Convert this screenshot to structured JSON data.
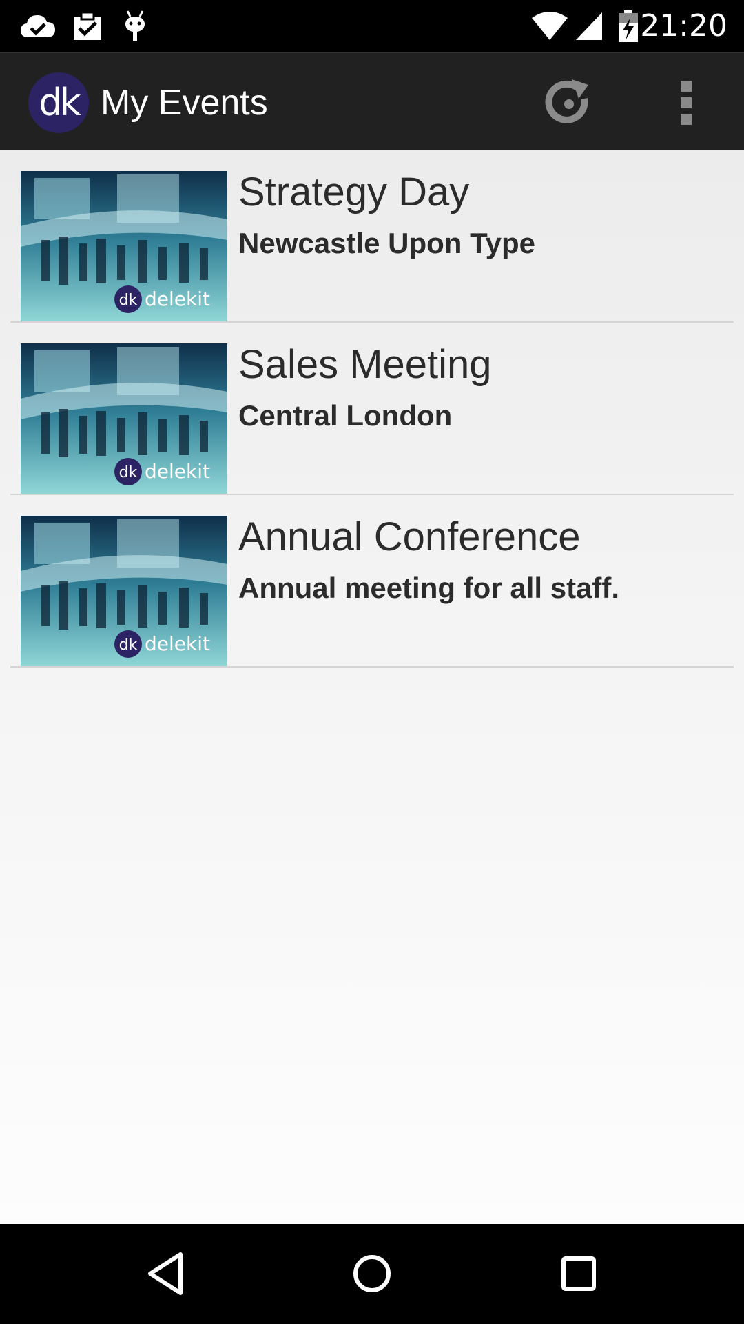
{
  "status_bar": {
    "time": "21:20",
    "icons": [
      "cloud-check-icon",
      "clipboard-check-icon",
      "android-debug-icon",
      "wifi-icon",
      "signal-icon",
      "battery-charging-icon"
    ]
  },
  "action_bar": {
    "logo_text": "dk",
    "title": "My Events",
    "actions": [
      "refresh-icon",
      "overflow-menu-icon"
    ]
  },
  "events": [
    {
      "title": "Strategy Day",
      "subtitle": "Newcastle Upon Type",
      "thumb_brand": "delekit",
      "thumb_badge": "dk"
    },
    {
      "title": "Sales Meeting",
      "subtitle": "Central London",
      "thumb_brand": "delekit",
      "thumb_badge": "dk"
    },
    {
      "title": "Annual Conference",
      "subtitle": "Annual meeting for all staff.",
      "thumb_brand": "delekit",
      "thumb_badge": "dk"
    }
  ],
  "nav_bar": {
    "buttons": [
      "back-icon",
      "home-icon",
      "recents-icon"
    ]
  },
  "colors": {
    "status_bar": "#000000",
    "action_bar": "#212121",
    "logo_bg": "#2b2363",
    "text": "#2b2b2b",
    "divider": "#d4d4d4"
  }
}
